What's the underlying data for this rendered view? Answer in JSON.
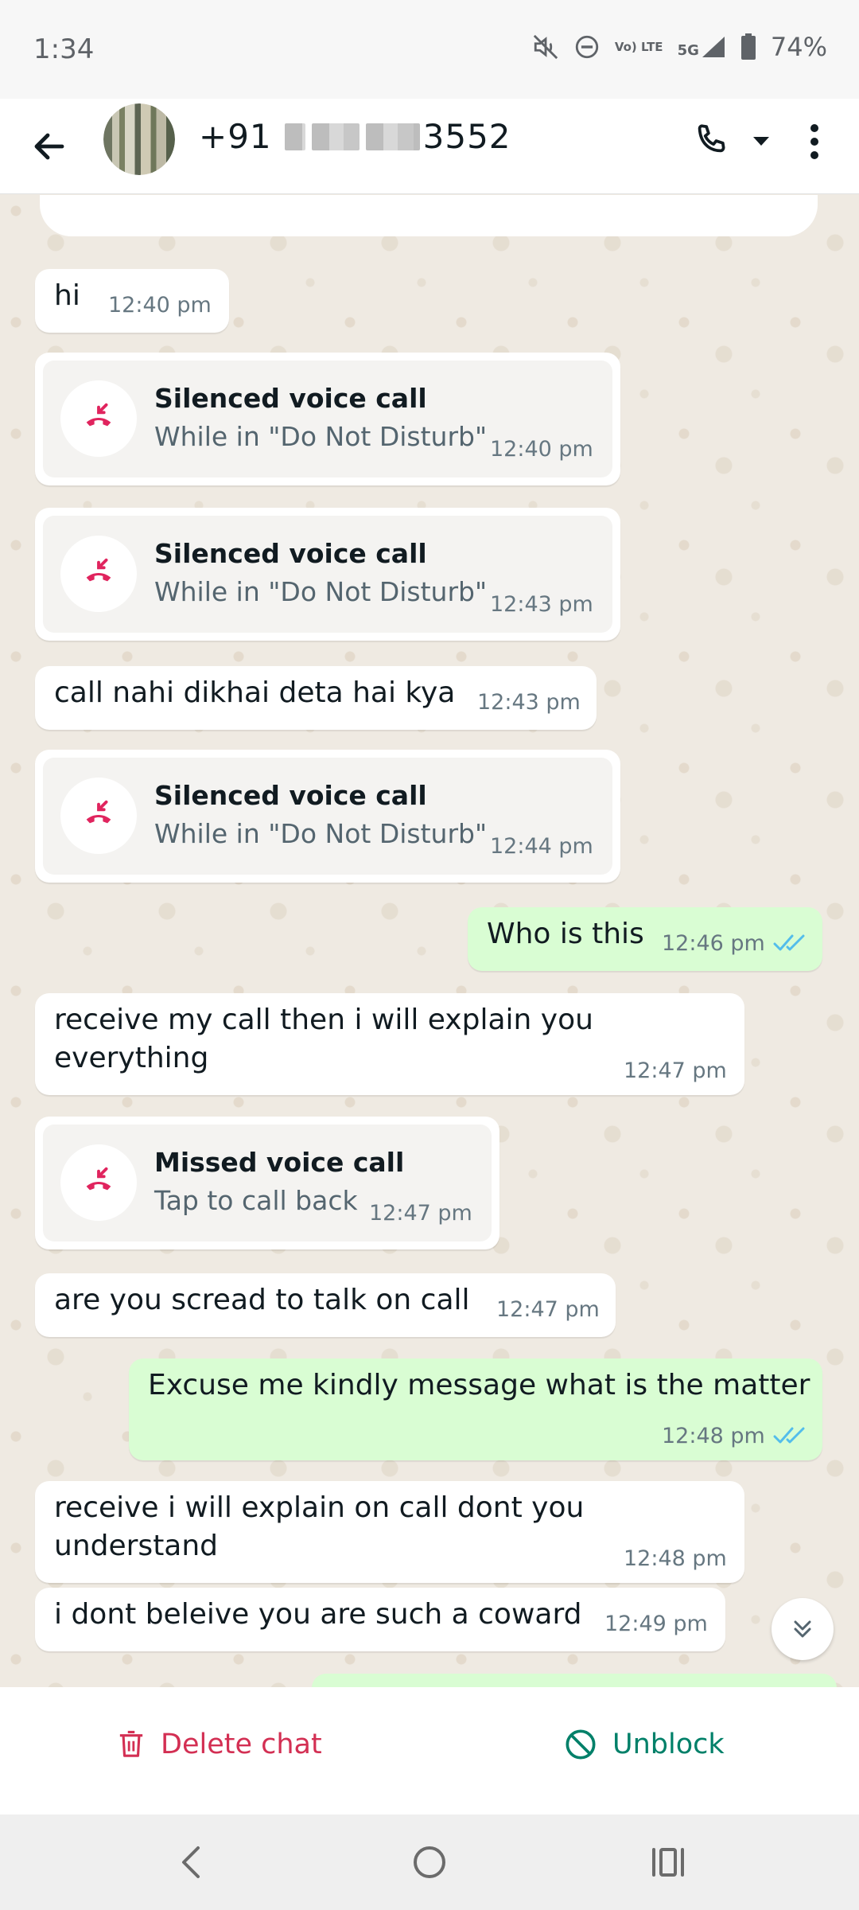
{
  "status_bar": {
    "time": "1:34",
    "network_label": "Vo) LTE",
    "network_type": "5G",
    "battery": "74%",
    "icons": [
      "mute-icon",
      "do-not-disturb-icon",
      "volte-icon",
      "signal-icon",
      "battery-icon"
    ]
  },
  "header": {
    "contact_prefix": "+91",
    "contact_suffix": "3552",
    "icons": [
      "back-arrow-icon",
      "phone-icon",
      "caret-down-icon",
      "more-vert-icon"
    ]
  },
  "messages": [
    {
      "type": "text",
      "direction": "in",
      "text": "hi",
      "time": "12:40 pm"
    },
    {
      "type": "call",
      "direction": "in",
      "title": "Silenced voice call",
      "subtitle": "While in \"Do Not Disturb\"",
      "time": "12:40 pm"
    },
    {
      "type": "call",
      "direction": "in",
      "title": "Silenced voice call",
      "subtitle": "While in \"Do Not Disturb\"",
      "time": "12:43 pm"
    },
    {
      "type": "text",
      "direction": "in",
      "text": "call nahi dikhai deta hai kya",
      "time": "12:43 pm"
    },
    {
      "type": "call",
      "direction": "in",
      "title": "Silenced voice call",
      "subtitle": "While in \"Do Not Disturb\"",
      "time": "12:44 pm"
    },
    {
      "type": "text",
      "direction": "out",
      "text": "Who is this",
      "time": "12:46 pm",
      "read": true
    },
    {
      "type": "text",
      "direction": "in",
      "text": "receive my call then i will explain you\neverything",
      "time": "12:47 pm"
    },
    {
      "type": "call",
      "direction": "in",
      "title": "Missed voice call",
      "subtitle": "Tap to call back",
      "time": "12:47 pm"
    },
    {
      "type": "text",
      "direction": "in",
      "text": "are you scread to talk on call",
      "time": "12:47 pm"
    },
    {
      "type": "text",
      "direction": "out",
      "text": "Excuse me kindly message what is the matter",
      "time": "12:48 pm",
      "read": true
    },
    {
      "type": "text",
      "direction": "in",
      "text": "receive i will explain on call dont you\nunderstand",
      "time": "12:48 pm"
    },
    {
      "type": "text",
      "direction": "in",
      "text": "i dont beleive you are such a coward",
      "time": "12:49 pm"
    }
  ],
  "actions": {
    "delete_label": "Delete chat",
    "unblock_label": "Unblock"
  },
  "colors": {
    "incoming_bubble": "#ffffff",
    "outgoing_bubble": "#d9fdd3",
    "missed_call_red": "#e0245e",
    "read_tick_blue": "#53bdeb",
    "delete_red": "#d32f53",
    "unblock_green": "#008069"
  }
}
